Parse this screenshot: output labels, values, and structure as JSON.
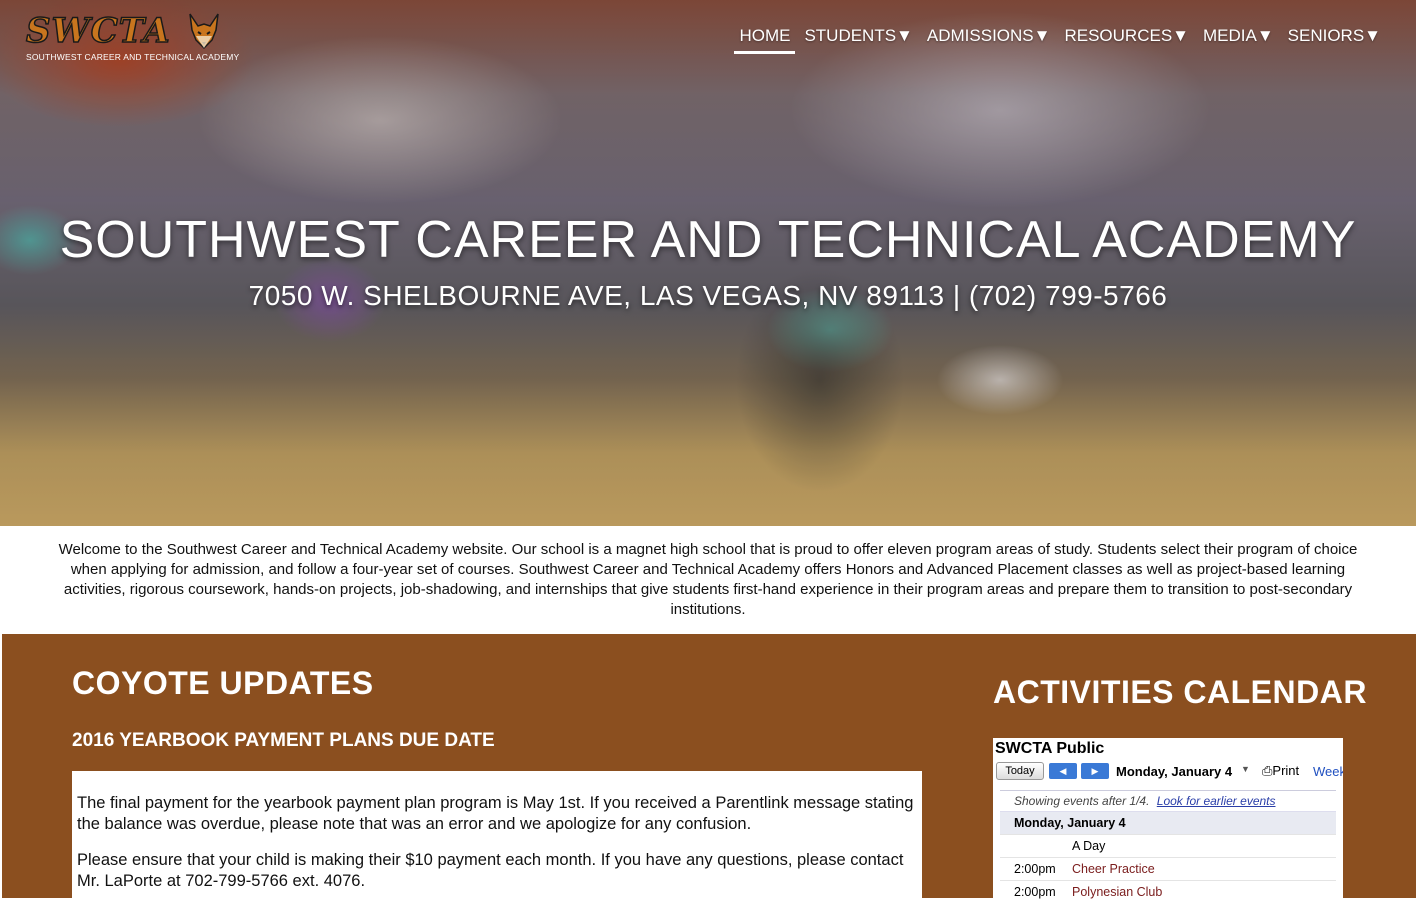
{
  "logo": {
    "text": "SWCTA",
    "subtitle": "SOUTHWEST CAREER AND TECHNICAL ACADEMY",
    "icon": "coyote-icon"
  },
  "nav": {
    "items": [
      {
        "label": "HOME",
        "active": true
      },
      {
        "label": "STUDENTS▼",
        "active": false
      },
      {
        "label": "ADMISSIONS▼",
        "active": false
      },
      {
        "label": "RESOURCES▼",
        "active": false
      },
      {
        "label": "MEDIA▼",
        "active": false
      },
      {
        "label": "SENIORS▼",
        "active": false
      }
    ]
  },
  "hero": {
    "title": "SOUTHWEST CAREER AND TECHNICAL ACADEMY",
    "address": "7050 W. SHELBOURNE AVE, LAS VEGAS, NV 89113 | (702) 799-5766"
  },
  "welcome": {
    "text": "Welcome to the Southwest Career and Technical Academy website. Our school is a magnet high school that is proud to offer eleven program areas of study. Students select their program of choice when applying for admission, and follow a four-year set of courses. Southwest Career and Technical Academy offers Honors and Advanced Placement classes as well as project-based learning activities, rigorous coursework, hands-on projects, job-shadowing, and internships that give students first-hand experience in their program areas and prepare them to transition to post-secondary institutions."
  },
  "updates": {
    "title": "COYOTE UPDATES",
    "post_title": "2016 YEARBOOK PAYMENT PLANS DUE DATE",
    "paragraphs": [
      "The final payment for the yearbook payment plan program is May 1st. If you received a Parentlink message stating the balance was overdue, please note that was an error and we apologize for any confusion.",
      "Please ensure that your child is making their $10 payment each month. If you have any questions, please contact Mr. LaPorte at 702-799-5766 ext. 4076."
    ]
  },
  "calendar": {
    "title": "ACTIVITIES CALENDAR",
    "name": "SWCTA Public",
    "today_label": "Today",
    "date_label": "Monday, January 4",
    "print_label": "Print",
    "week_label": "Week",
    "info_text": "Showing events after 1/4.",
    "info_link": "Look for earlier events",
    "day_header": "Monday, January 4",
    "events": [
      {
        "time": "",
        "title": "A Day"
      },
      {
        "time": "2:00pm",
        "title": "Cheer Practice"
      },
      {
        "time": "2:00pm",
        "title": "Polynesian Club"
      }
    ],
    "colors": {
      "accent": "#3a79d6",
      "event_text": "#7a1c1c"
    }
  },
  "colors": {
    "brand_brown": "#8b4f1f",
    "logo_orange": "#c8751e"
  }
}
